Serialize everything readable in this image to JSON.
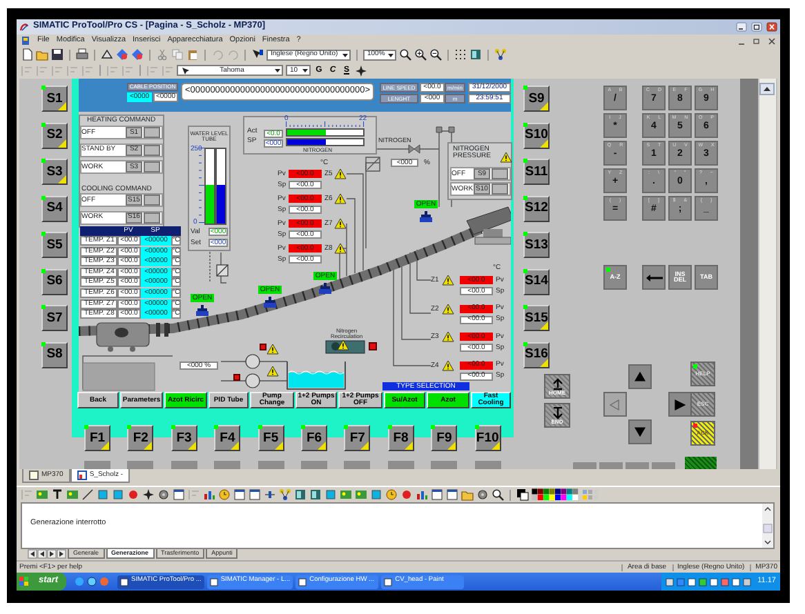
{
  "window": {
    "title": "SIMATIC ProTool/Pro CS - [Pagina - S_Scholz - MP370]"
  },
  "menu": [
    "File",
    "Modifica",
    "Visualizza",
    "Inserisci",
    "Apparecchiatura",
    "Opzioni",
    "Finestra",
    "?"
  ],
  "toolbar": {
    "language": "Inglese (Regno Unito)",
    "zoom": "100%",
    "font": "Tahoma",
    "font_size": "10",
    "styles": [
      {
        "label": "G",
        "kind": "bold"
      },
      {
        "label": "C",
        "kind": "italic"
      },
      {
        "label": "S",
        "kind": "underline"
      }
    ]
  },
  "device": {
    "s_keys_left": [
      {
        "label": "S1",
        "flag": true,
        "led": true
      },
      {
        "label": "S2",
        "flag": true,
        "led": true
      },
      {
        "label": "S3",
        "flag": true,
        "led": true
      },
      {
        "label": "S4",
        "flag": false,
        "led": true
      },
      {
        "label": "S5",
        "flag": false,
        "led": true
      },
      {
        "label": "S6",
        "flag": false,
        "led": true
      },
      {
        "label": "S7",
        "flag": false,
        "led": true
      },
      {
        "label": "S8",
        "flag": false,
        "led": true
      }
    ],
    "s_keys_right": [
      {
        "label": "S9",
        "flag": true,
        "led": true
      },
      {
        "label": "S10",
        "flag": true,
        "led": true
      },
      {
        "label": "S11",
        "flag": false,
        "led": true
      },
      {
        "label": "S12",
        "flag": false,
        "led": true
      },
      {
        "label": "S13",
        "flag": false,
        "led": true
      },
      {
        "label": "S14",
        "flag": false,
        "led": true
      },
      {
        "label": "S15",
        "flag": true,
        "led": true
      },
      {
        "label": "S16",
        "flag": true,
        "led": true
      }
    ],
    "f_keys": [
      {
        "label": "F1",
        "flag": true,
        "led": true
      },
      {
        "label": "F2",
        "flag": true,
        "led": true
      },
      {
        "label": "F3",
        "flag": true,
        "led": true
      },
      {
        "label": "F4",
        "flag": true,
        "led": true
      },
      {
        "label": "F5",
        "flag": true,
        "led": true
      },
      {
        "label": "F6",
        "flag": true,
        "led": true
      },
      {
        "label": "F7",
        "flag": true,
        "led": true
      },
      {
        "label": "F8",
        "flag": true,
        "led": true
      },
      {
        "label": "F9",
        "flag": true,
        "led": true
      },
      {
        "label": "F10",
        "flag": true,
        "led": true
      }
    ],
    "screen": {
      "cable_position": {
        "label": "CABLE POSITION",
        "values": [
          "<0000",
          "<0000"
        ],
        "bar": "<00000000000000000000000000000000000>"
      },
      "line_speed": {
        "label": "LINE SPEED",
        "value": "<00.0",
        "unit": "m/min"
      },
      "length": {
        "label": "LENGHT",
        "value": "<000",
        "unit": "m"
      },
      "date": "31/12/2000",
      "time": "23:59:51",
      "heating": {
        "title": "HEATING COMMAND",
        "rows": [
          {
            "label": "OFF",
            "key": "S1"
          },
          {
            "label": "STAND BY",
            "key": "S2"
          },
          {
            "label": "WORK",
            "key": "S3"
          }
        ]
      },
      "cooling": {
        "title": "COOLING COMMAND",
        "rows": [
          {
            "label": "OFF",
            "key": "S15"
          },
          {
            "label": "WORK",
            "key": "S16"
          }
        ]
      },
      "temperatures": {
        "columns": [
          "PV",
          "SP"
        ],
        "rows": [
          {
            "zone": "TEMP. Z1",
            "pv": "<00.0",
            "sp": "<00000",
            "unit": "°C"
          },
          {
            "zone": "TEMP. Z2",
            "pv": "<00.0",
            "sp": "<00000",
            "unit": "°C"
          },
          {
            "zone": "TEMP. Z3",
            "pv": "<00.0",
            "sp": "<00000",
            "unit": "°C"
          },
          {
            "zone": "TEMP. Z4",
            "pv": "<00.0",
            "sp": "<00000",
            "unit": "°C"
          },
          {
            "zone": "TEMP. Z5",
            "pv": "<00.0",
            "sp": "<00000",
            "unit": "°C"
          },
          {
            "zone": "TEMP. Z6",
            "pv": "<00.0",
            "sp": "<00000",
            "unit": "°C"
          },
          {
            "zone": "TEMP. Z7",
            "pv": "<00.0",
            "sp": "<00000",
            "unit": "°C"
          },
          {
            "zone": "TEMP. Z8",
            "pv": "<00.0",
            "sp": "<00000",
            "unit": "°C"
          }
        ]
      },
      "water_level": {
        "title": "WATER LEVEL TUBE",
        "scale_max": "250",
        "scale_min": "0",
        "bars": [
          {
            "level": 0.52,
            "color": "#00dd00"
          },
          {
            "level": 0.52,
            "color": "#0000dd"
          }
        ],
        "val_label": "Val",
        "val": "<000",
        "set_label": "Set",
        "set": "<000"
      },
      "nitrogen": {
        "act_label": "Act",
        "act": "<0.0",
        "sp_label": "SP",
        "sp": "<000",
        "scale_min": "0",
        "scale_max": "22",
        "bars": [
          {
            "level": 0.5,
            "color": "#00dd00"
          },
          {
            "level": 0.5,
            "color": "#0000dd"
          }
        ],
        "label": "NITROGEN"
      },
      "nitrogen_valve": {
        "label": "NITROGEN",
        "value": "<000",
        "unit": "%"
      },
      "nitrogen_pressure": {
        "title": "NITROGEN PRESSURE",
        "rows": [
          {
            "label": "OFF",
            "key": "S9"
          },
          {
            "label": "WORK",
            "key": "S10"
          }
        ]
      },
      "zones_left": {
        "unit": "°C",
        "zones": [
          {
            "name": "Z5",
            "pv_label": "Pv",
            "pv": "<00.0",
            "sp_label": "Sp",
            "sp": "<00.0"
          },
          {
            "name": "Z6",
            "pv_label": "Pv",
            "pv": "<00.0",
            "sp_label": "Sp",
            "sp": "<00.0"
          },
          {
            "name": "Z7",
            "pv_label": "Pv",
            "pv": "<00.0",
            "sp_label": "Sp",
            "sp": "<00.0"
          },
          {
            "name": "Z8",
            "pv_label": "Pv",
            "pv": "<00.0",
            "sp_label": "Sp",
            "sp": "<00.0"
          }
        ]
      },
      "zones_right": {
        "unit": "°C",
        "zones": [
          {
            "name": "Z1",
            "pv_label": "Pv",
            "pv": "<00.0",
            "sp_label": "Sp",
            "sp": "<00.0"
          },
          {
            "name": "Z2",
            "pv_label": "Pv",
            "pv": "<00.0",
            "sp_label": "Sp",
            "sp": "<00.0"
          },
          {
            "name": "Z3",
            "pv_label": "Pv",
            "pv": "<00.0",
            "sp_label": "Sp",
            "sp": "<00.0"
          },
          {
            "name": "Z4",
            "pv_label": "Pv",
            "pv": "<00.0",
            "sp_label": "Sp",
            "sp": "<00.0"
          }
        ]
      },
      "valves": [
        {
          "label": "OPEN"
        },
        {
          "label": "OPEN"
        },
        {
          "label": "OPEN"
        },
        {
          "label": "OPEN"
        }
      ],
      "recirculation": "Nitrogen Recirculation",
      "pump_speed": "<000 %",
      "type_selection": "TYPE SELECTION",
      "buttons": [
        {
          "label": "Back",
          "color": "#c0c0c0"
        },
        {
          "label": "Parameters",
          "color": "#c0c0c0"
        },
        {
          "label": "Azot Ricirc",
          "color": "#00e000"
        },
        {
          "label": "PID Tube",
          "color": "#c0c0c0"
        },
        {
          "label": "Pump Change",
          "color": "#c0c0c0"
        },
        {
          "label": "1+2 Pumps ON",
          "color": "#c0c0c0"
        },
        {
          "label": "1+2 Pumps OFF",
          "color": "#c0c0c0"
        },
        {
          "label": "Su/Azot",
          "color": "#00e000"
        },
        {
          "label": "Azot",
          "color": "#00e000"
        },
        {
          "label": "Fast Cooling",
          "color": "#00ffff"
        }
      ]
    },
    "keypad": [
      {
        "label": "/",
        "sub": "A B"
      },
      {
        "label": "7",
        "sub": "C D"
      },
      {
        "label": "8",
        "sub": "E F"
      },
      {
        "label": "9",
        "sub": "G H"
      },
      {
        "label": "*",
        "sub": "I J"
      },
      {
        "label": "4",
        "sub": "K L"
      },
      {
        "label": "5",
        "sub": "M N"
      },
      {
        "label": "6",
        "sub": "O P"
      },
      {
        "label": "-",
        "sub": "Q R"
      },
      {
        "label": "1",
        "sub": "S T"
      },
      {
        "label": "2",
        "sub": "U V"
      },
      {
        "label": "3",
        "sub": "W X"
      },
      {
        "label": "+",
        "sub": "Y Z"
      },
      {
        "label": ".",
        "sub": ": \\"
      },
      {
        "label": "0",
        "sub": "\" °"
      },
      {
        "label": ",",
        "sub": "? ~"
      },
      {
        "label": "=",
        "sub": "( )"
      },
      {
        "label": "#",
        "sub": "[ ]"
      },
      {
        "label": ";",
        "sub": "$ &"
      },
      {
        "label": "_",
        "sub": "{ }"
      }
    ],
    "edit_keys": [
      {
        "kind": "text",
        "label": "A-Z",
        "led": true
      },
      {
        "kind": "backspace"
      },
      {
        "kind": "text",
        "label": "INS DEL"
      },
      {
        "kind": "text",
        "label": "TAB"
      }
    ],
    "arrows": [
      {
        "kind": "up",
        "disabled": false
      },
      {
        "kind": "left",
        "disabled": true
      },
      {
        "kind": "right",
        "disabled": false
      },
      {
        "kind": "down",
        "disabled": false
      }
    ],
    "nav_keys": [
      {
        "kind": "home",
        "label": "HOME"
      },
      {
        "kind": "end",
        "label": "END"
      }
    ],
    "system_keys": [
      {
        "label": "HELP",
        "led": true,
        "alarm": false
      },
      {
        "label": "ESC",
        "led": false,
        "alarm": false
      },
      {
        "label": "ACK",
        "led": true,
        "alarm": true
      }
    ]
  },
  "documents": [
    {
      "label": "MP370",
      "selected": false
    },
    {
      "label": "S_Scholz -",
      "selected": true
    }
  ],
  "output": {
    "text": "Generazione interrotto",
    "tabs": [
      {
        "label": "Generale",
        "selected": false
      },
      {
        "label": "Generazione",
        "selected": true
      },
      {
        "label": "Trasferimento",
        "selected": false
      },
      {
        "label": "Appunti",
        "selected": false
      }
    ]
  },
  "status_bar": {
    "help": "Premi <F1> per help",
    "fields": [
      "Area di base",
      "Inglese (Regno Unito)",
      "MP370"
    ]
  },
  "taskbar": {
    "start": "start",
    "items": [
      {
        "label": "SIMATIC ProTool/Pro ...",
        "selected": true
      },
      {
        "label": "SIMATIC Manager - L...",
        "selected": false
      },
      {
        "label": "Configurazione HW ...",
        "selected": false
      },
      {
        "label": "CV_head - Paint",
        "selected": false
      }
    ],
    "clock": "11.17"
  }
}
